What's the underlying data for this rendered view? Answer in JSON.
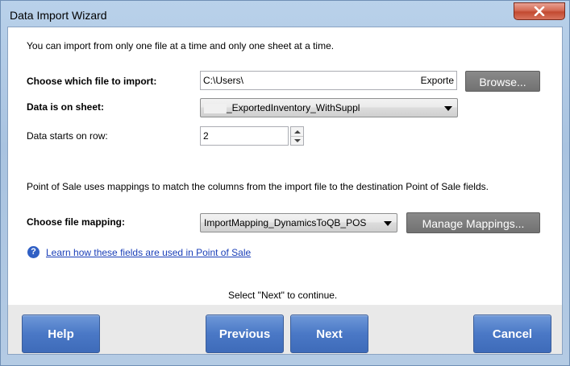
{
  "window": {
    "title": "Data Import Wizard"
  },
  "intro": {
    "text": "You can import from only one file at a time and only one sheet at a time."
  },
  "file": {
    "label": "Choose which file to import:",
    "value_start": "C:\\Users\\",
    "value_end": "Exporte",
    "browse_label": "Browse..."
  },
  "sheet": {
    "label": "Data is on sheet:",
    "value": "_ExportedInventory_WithSuppl"
  },
  "row": {
    "label": "Data starts on row:",
    "value": "2"
  },
  "mapping_info": {
    "text": "Point of Sale uses mappings to match the columns from the import file to the destination Point of Sale fields."
  },
  "mapping": {
    "label": "Choose file mapping:",
    "value": "ImportMapping_DynamicsToQB_POS",
    "manage_label": "Manage Mappings..."
  },
  "learn": {
    "link_text": "Learn how these fields are used in Point of Sale"
  },
  "instruction": {
    "text": "Select \"Next\" to continue."
  },
  "buttons": {
    "help": "Help",
    "previous": "Previous",
    "next": "Next",
    "cancel": "Cancel"
  }
}
